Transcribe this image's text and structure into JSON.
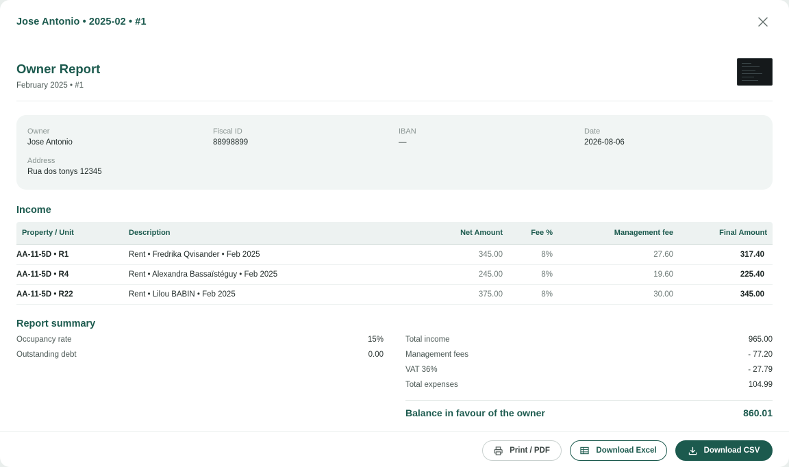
{
  "header": {
    "title": "Jose Antonio • 2025-02 • #1"
  },
  "report": {
    "title": "Owner Report",
    "subtitle": "February 2025 • #1"
  },
  "owner_info": {
    "owner_label": "Owner",
    "owner_value": "Jose Antonio",
    "fiscal_label": "Fiscal ID",
    "fiscal_value": "88998899",
    "iban_label": "IBAN",
    "iban_value": "—",
    "date_label": "Date",
    "date_value": "2026-08-06",
    "address_label": "Address",
    "address_value": "Rua dos tonys 12345"
  },
  "income": {
    "title": "Income",
    "columns": [
      "Property / Unit",
      "Description",
      "Net Amount",
      "Fee %",
      "Management fee",
      "Final Amount"
    ],
    "rows": [
      {
        "unit": "AA-11-5D • R1",
        "description": "Rent • Fredrika Qvisander • Feb 2025",
        "net": "345.00",
        "fee_pct": "8%",
        "mgmt_fee": "27.60",
        "final": "317.40"
      },
      {
        "unit": "AA-11-5D • R4",
        "description": "Rent • Alexandra Bassaïstéguy • Feb 2025",
        "net": "245.00",
        "fee_pct": "8%",
        "mgmt_fee": "19.60",
        "final": "225.40"
      },
      {
        "unit": "AA-11-5D • R22",
        "description": "Rent • Lilou BABIN • Feb 2025",
        "net": "375.00",
        "fee_pct": "8%",
        "mgmt_fee": "30.00",
        "final": "345.00"
      }
    ]
  },
  "summary": {
    "title": "Report summary",
    "left": [
      {
        "label": "Occupancy rate",
        "value": "15%"
      },
      {
        "label": "Outstanding debt",
        "value": "0.00"
      }
    ],
    "right": [
      {
        "label": "Total income",
        "value": "965.00"
      },
      {
        "label": "Management fees",
        "value": "- 77.20"
      },
      {
        "label": "VAT 36%",
        "value": "- 27.79"
      },
      {
        "label": "Total expenses",
        "value": "104.99"
      }
    ],
    "balance_label": "Balance in favour of the owner",
    "balance_value": "860.01"
  },
  "footer": {
    "print_label": "Print / PDF",
    "excel_label": "Download Excel",
    "csv_label": "Download CSV"
  },
  "colors": {
    "brand": "#1c5a4e",
    "card_bg": "#f1f5f4",
    "header_bg": "#edf2f1"
  },
  "icons": [
    "close-icon",
    "printer-icon",
    "spreadsheet-icon",
    "download-icon"
  ]
}
